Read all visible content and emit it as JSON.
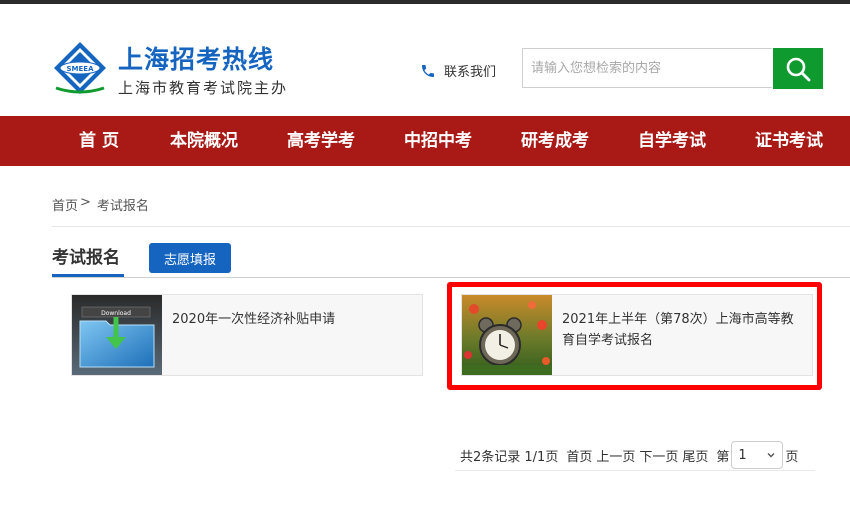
{
  "header": {
    "site_title": "上海招考热线",
    "site_subtitle": "上海市教育考试院主办",
    "logo_text": "SMEEA",
    "contact_label": "联系我们",
    "search": {
      "placeholder": "请输入您想检索的内容",
      "value": ""
    }
  },
  "nav": {
    "items": [
      {
        "label": "首 页"
      },
      {
        "label": "本院概况"
      },
      {
        "label": "高考学考"
      },
      {
        "label": "中招中考"
      },
      {
        "label": "研考成考"
      },
      {
        "label": "自学考试"
      },
      {
        "label": "证书考试"
      }
    ]
  },
  "breadcrumb": {
    "home": "首页",
    "separator": ">",
    "current": "考试报名"
  },
  "section": {
    "title": "考试报名",
    "tab_button": "志愿填报"
  },
  "cards": [
    {
      "title": "2020年一次性经济补贴申请",
      "thumb_label": "Download",
      "icon": "download-folder-icon"
    },
    {
      "title": "2021年上半年（第78次）上海市高等教育自学考试报名",
      "icon": "alarm-clock-image",
      "highlighted": true
    }
  ],
  "pager": {
    "summary": "共2条记录 1/1页",
    "first": "首页",
    "prev": "上一页",
    "next": "下一页",
    "last": "尾页",
    "page_prefix": "第",
    "page_value": "1",
    "page_suffix": "页"
  },
  "colors": {
    "brand_blue": "#1565c0",
    "nav_red": "#a91a17",
    "search_green": "#0f9a2f",
    "highlight_red": "#ff0000"
  }
}
